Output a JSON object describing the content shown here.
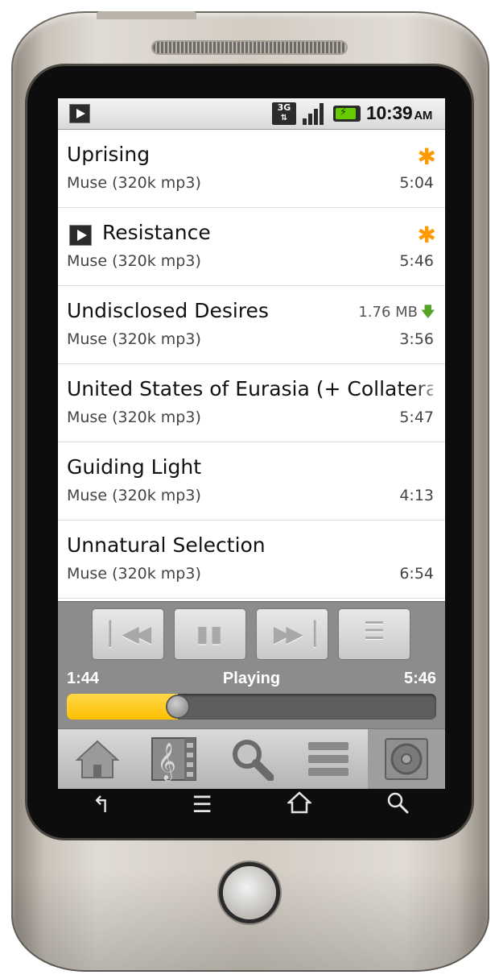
{
  "status_bar": {
    "network": "3G",
    "clock": "10:39",
    "ampm": "AM",
    "battery_color": "#66cc00"
  },
  "tracks": [
    {
      "title": "Uprising",
      "artist": "Muse (320k mp3)",
      "duration": "5:04",
      "badge": "✱",
      "size": ""
    },
    {
      "title": "Resistance",
      "artist": "Muse (320k mp3)",
      "duration": "5:46",
      "badge": "✱",
      "size": "",
      "now_playing": true
    },
    {
      "title": "Undisclosed Desires",
      "artist": "Muse (320k mp3)",
      "duration": "3:56",
      "badge": "",
      "size": "1.76 MB"
    },
    {
      "title": "United States of Eurasia (+ Collateral D",
      "artist": "Muse (320k mp3)",
      "duration": "5:47",
      "badge": "",
      "size": ""
    },
    {
      "title": "Guiding Light",
      "artist": "Muse (320k mp3)",
      "duration": "4:13",
      "badge": "",
      "size": ""
    },
    {
      "title": "Unnatural Selection",
      "artist": "Muse (320k mp3)",
      "duration": "6:54",
      "badge": "",
      "size": ""
    }
  ],
  "player": {
    "elapsed": "1:44",
    "state": "Playing",
    "total": "5:46",
    "progress_fraction": 0.3,
    "accent_color": "#ffbf00",
    "buttons": [
      "previous-icon",
      "pause-icon",
      "next-icon",
      "queue-icon"
    ]
  },
  "tabs": [
    {
      "name": "home",
      "icon": "home-icon"
    },
    {
      "name": "library",
      "icon": "music-library-icon"
    },
    {
      "name": "search",
      "icon": "search-icon"
    },
    {
      "name": "playlists",
      "icon": "list-icon"
    },
    {
      "name": "now-playing",
      "icon": "disc-icon",
      "active": true
    }
  ],
  "hardware_keys": [
    "back-icon",
    "menu-icon",
    "home-icon",
    "search-icon"
  ]
}
